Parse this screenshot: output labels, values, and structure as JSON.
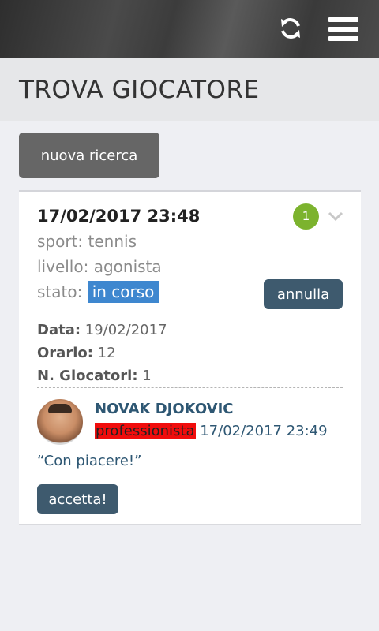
{
  "header": {
    "refresh_icon": "refresh-icon",
    "menu_icon": "hamburger-menu-icon"
  },
  "page": {
    "title": "TROVA GIOCATORE"
  },
  "actions": {
    "new_search_label": "nuova ricerca"
  },
  "request": {
    "datetime": "17/02/2017 23:48",
    "responses_count": "1",
    "sport": "sport: tennis",
    "level": "livello: agonista",
    "status_label": "stato:",
    "status_value": "in corso",
    "cancel_label": "annulla",
    "date_label": "Data:",
    "date_value": "19/02/2017",
    "time_label": "Orario:",
    "time_value": "12",
    "players_label": "N. Giocatori:",
    "players_value": "1"
  },
  "response": {
    "player_name": "NOVAK DJOKOVIC",
    "player_level": "professionista",
    "timestamp": "17/02/2017 23:49",
    "message": "“Con piacere!”",
    "accept_label": "accetta!"
  },
  "colors": {
    "badge": "#7cb32e",
    "status_badge": "#3e87cf",
    "level_highlight": "#f00d0d",
    "button_dark": "#3e5a6e"
  }
}
